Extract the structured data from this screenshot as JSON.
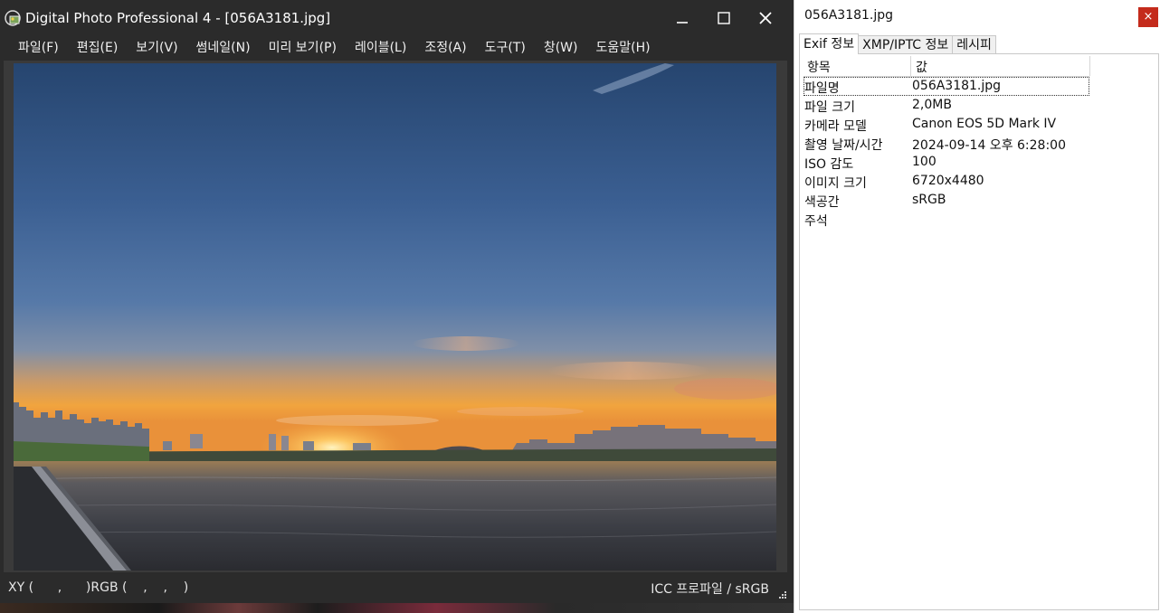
{
  "window": {
    "title": "Digital Photo Professional 4 - [056A3181.jpg]",
    "icon": "dpp-app-icon"
  },
  "menu": [
    {
      "label": "파일(F)"
    },
    {
      "label": "편집(E)"
    },
    {
      "label": "보기(V)"
    },
    {
      "label": "썸네일(N)"
    },
    {
      "label": "미리 보기(P)"
    },
    {
      "label": "레이블(L)"
    },
    {
      "label": "조정(A)"
    },
    {
      "label": "도구(T)"
    },
    {
      "label": "창(W)"
    },
    {
      "label": "도움말(H)"
    }
  ],
  "status": {
    "left": "XY (      ,      )RGB (    ,    ,    )",
    "right": "ICC 프로파일 / sRGB"
  },
  "info_panel": {
    "title": "056A3181.jpg",
    "close_label": "×",
    "tabs": [
      {
        "label": "Exif 정보",
        "active": true
      },
      {
        "label": "XMP/IPTC 정보",
        "active": false
      },
      {
        "label": "레시피",
        "active": false
      }
    ],
    "table": {
      "headers": [
        "항목",
        "값"
      ],
      "rows": [
        {
          "key": "파일명",
          "value": "056A3181.jpg",
          "selected": true
        },
        {
          "key": "파일 크기",
          "value": "2,0MB"
        },
        {
          "key": "카메라 모델",
          "value": "Canon EOS 5D Mark IV"
        },
        {
          "key": "촬영 날짜/시간",
          "value": "2024-09-14 오후 6:28:00"
        },
        {
          "key": "ISO 감도",
          "value": "100"
        },
        {
          "key": "이미지 크기",
          "value": "6720x4480"
        },
        {
          "key": "색공간",
          "value": "sRGB"
        },
        {
          "key": "주석",
          "value": ""
        }
      ]
    }
  },
  "colors": {
    "window_bg": "#2b2b2b",
    "close_red": "#c42b1c",
    "sky_top": "#2b4a78",
    "sunset": "#f2a641"
  }
}
